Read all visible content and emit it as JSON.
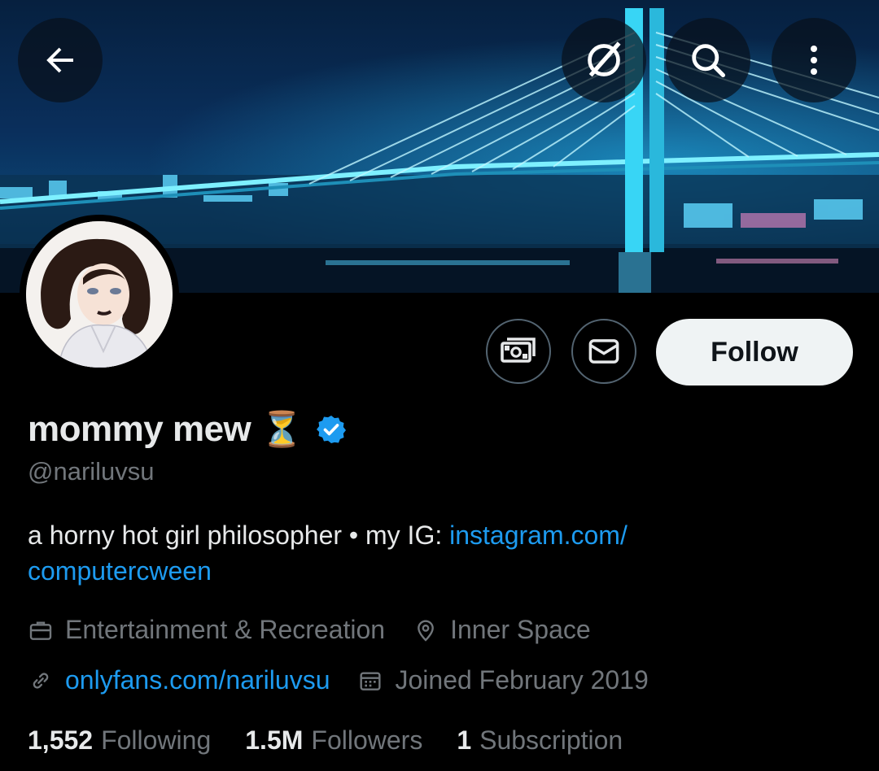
{
  "header": {
    "back_icon": "arrow-left-icon",
    "grok_icon": "grok-slash-icon",
    "search_icon": "search-icon",
    "more_icon": "more-vertical-icon"
  },
  "profile_actions": {
    "subscribe_icon": "money-icon",
    "message_icon": "envelope-icon",
    "follow_label": "Follow"
  },
  "profile": {
    "display_name": "mommy mew",
    "name_emoji": "⏳",
    "verified_icon": "verified-badge-icon",
    "handle": "@nariluvsu",
    "bio_text": "a horny hot girl philosopher • my IG: ",
    "bio_link": "instagram.com/computercween",
    "bio_link_part1": "instagram.com/",
    "bio_link_part2": "computercween",
    "category": "Entertainment & Recreation",
    "location": "Inner Space",
    "website": "onlyfans.com/nariluvsu",
    "joined": "Joined February 2019"
  },
  "stats": {
    "following_count": "1,552",
    "following_label": "Following",
    "followers_count": "1.5M",
    "followers_label": "Followers",
    "subscription_count": "1",
    "subscription_label": "Subscription"
  },
  "colors": {
    "background": "#000000",
    "link": "#1d9bf0",
    "muted": "#71767b",
    "verified": "#1d9bf0"
  }
}
